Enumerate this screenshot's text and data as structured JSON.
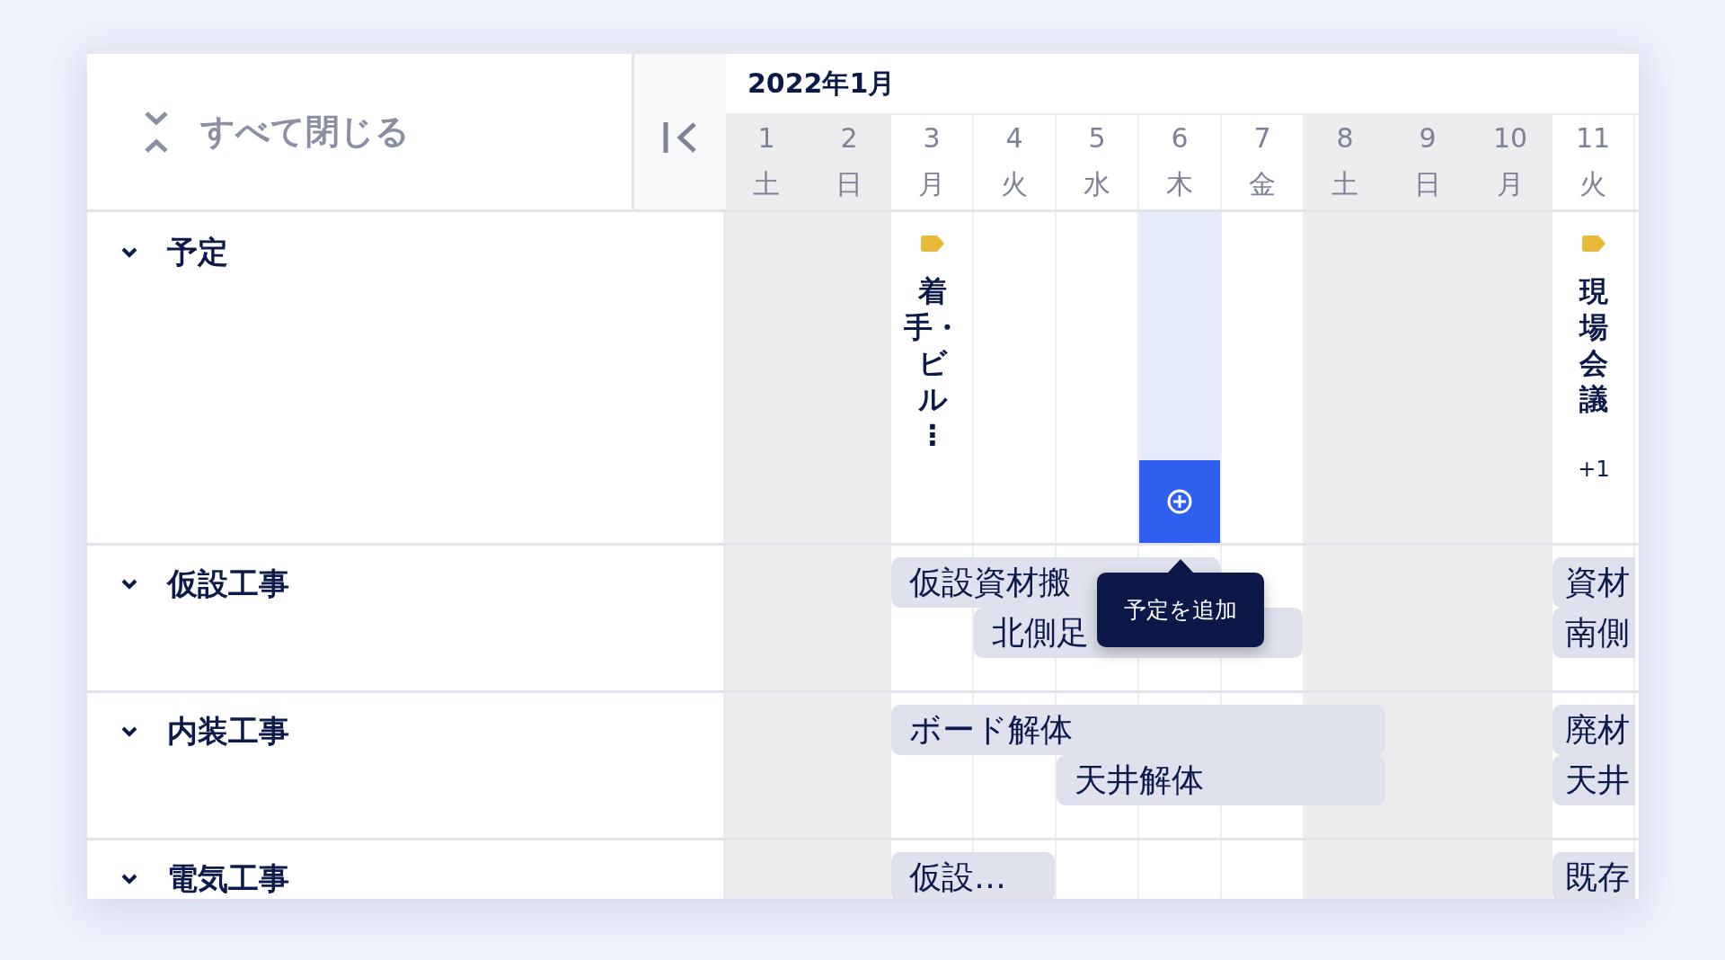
{
  "toolbar": {
    "collapse_all": "すべて閉じる"
  },
  "month": "2022年1月",
  "days": [
    {
      "day": "1",
      "weekday": "土",
      "holiday": true,
      "hovered": false
    },
    {
      "day": "2",
      "weekday": "日",
      "holiday": true,
      "hovered": false
    },
    {
      "day": "3",
      "weekday": "月",
      "holiday": false,
      "hovered": false
    },
    {
      "day": "4",
      "weekday": "火",
      "holiday": false,
      "hovered": false
    },
    {
      "day": "5",
      "weekday": "水",
      "holiday": false,
      "hovered": false
    },
    {
      "day": "6",
      "weekday": "木",
      "holiday": false,
      "hovered": true
    },
    {
      "day": "7",
      "weekday": "金",
      "holiday": false,
      "hovered": false
    },
    {
      "day": "8",
      "weekday": "土",
      "holiday": true,
      "hovered": false
    },
    {
      "day": "9",
      "weekday": "日",
      "holiday": true,
      "hovered": false
    },
    {
      "day": "10",
      "weekday": "月",
      "holiday": true,
      "hovered": false
    },
    {
      "day": "11",
      "weekday": "火",
      "holiday": false,
      "hovered": false
    }
  ],
  "sections": [
    {
      "kind": "milestones",
      "title": "予定",
      "expanded": true,
      "add_tooltip": "予定を追加",
      "cells": [
        {
          "kind": "empty"
        },
        {
          "kind": "empty"
        },
        {
          "kind": "event",
          "label": "着手・ビル⋮"
        },
        {
          "kind": "empty"
        },
        {
          "kind": "empty"
        },
        {
          "kind": "empty"
        },
        {
          "kind": "empty"
        },
        {
          "kind": "empty"
        },
        {
          "kind": "empty"
        },
        {
          "kind": "empty"
        },
        {
          "kind": "event",
          "label": "現場会議",
          "more": "+1"
        }
      ]
    },
    {
      "kind": "tasks",
      "title": "仮設工事",
      "expanded": true,
      "lanes": [
        {
          "cells": [
            {
              "kind": "empty"
            },
            {
              "kind": "empty"
            },
            {
              "kind": "start",
              "label": "仮設資材搬"
            },
            {
              "kind": "continue"
            },
            {
              "kind": "continue"
            },
            {
              "kind": "continue"
            },
            {
              "kind": "empty"
            },
            {
              "kind": "empty"
            },
            {
              "kind": "empty"
            },
            {
              "kind": "empty"
            },
            {
              "kind": "start",
              "label": "資材"
            }
          ]
        },
        {
          "cells": [
            {
              "kind": "empty"
            },
            {
              "kind": "empty"
            },
            {
              "kind": "empty"
            },
            {
              "kind": "start",
              "label": "北側足"
            },
            {
              "kind": "continue"
            },
            {
              "kind": "continue"
            },
            {
              "kind": "continue"
            },
            {
              "kind": "empty"
            },
            {
              "kind": "empty"
            },
            {
              "kind": "empty"
            },
            {
              "kind": "start",
              "label": "南側"
            }
          ]
        }
      ]
    },
    {
      "kind": "tasks",
      "title": "内装工事",
      "expanded": true,
      "lanes": [
        {
          "cells": [
            {
              "kind": "empty"
            },
            {
              "kind": "empty"
            },
            {
              "kind": "start",
              "label": "ボード解体"
            },
            {
              "kind": "continue"
            },
            {
              "kind": "continue"
            },
            {
              "kind": "continue"
            },
            {
              "kind": "continue"
            },
            {
              "kind": "continue"
            },
            {
              "kind": "empty"
            },
            {
              "kind": "empty"
            },
            {
              "kind": "start",
              "label": "廃材"
            }
          ]
        },
        {
          "cells": [
            {
              "kind": "empty"
            },
            {
              "kind": "empty"
            },
            {
              "kind": "empty"
            },
            {
              "kind": "empty"
            },
            {
              "kind": "start",
              "label": "天井解体"
            },
            {
              "kind": "continue"
            },
            {
              "kind": "continue"
            },
            {
              "kind": "continue"
            },
            {
              "kind": "empty"
            },
            {
              "kind": "empty"
            },
            {
              "kind": "start",
              "label": "天井"
            }
          ]
        }
      ]
    },
    {
      "kind": "tasks",
      "title": "電気工事",
      "expanded": true,
      "lanes": [
        {
          "cells": [
            {
              "kind": "empty"
            },
            {
              "kind": "empty"
            },
            {
              "kind": "start",
              "label": "仮設…"
            },
            {
              "kind": "continue"
            },
            {
              "kind": "empty"
            },
            {
              "kind": "empty"
            },
            {
              "kind": "empty"
            },
            {
              "kind": "empty"
            },
            {
              "kind": "empty"
            },
            {
              "kind": "empty"
            },
            {
              "kind": "start",
              "label": "既存"
            }
          ]
        }
      ]
    }
  ]
}
